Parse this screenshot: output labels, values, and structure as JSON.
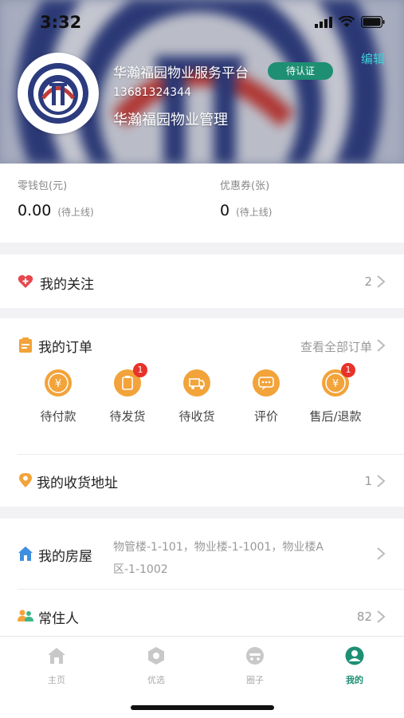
{
  "status": {
    "time": "3:32"
  },
  "profile": {
    "name": "华瀚福园物业服务平台",
    "badge": "待认证",
    "phone": "13681324344",
    "org": "华瀚福园物业管理",
    "edit": "编辑"
  },
  "wallet": {
    "balance_label": "零钱包(元)",
    "balance_value": "0.00",
    "balance_tag": "(待上线)",
    "coupon_label": "优惠券(张)",
    "coupon_value": "0",
    "coupon_tag": "(待上线)"
  },
  "follow": {
    "label": "我的关注",
    "count": "2"
  },
  "orders": {
    "title": "我的订单",
    "view_all": "查看全部订单",
    "items": [
      {
        "label": "待付款",
        "badge": ""
      },
      {
        "label": "待发货",
        "badge": "1"
      },
      {
        "label": "待收货",
        "badge": ""
      },
      {
        "label": "评价",
        "badge": ""
      },
      {
        "label": "售后/退款",
        "badge": "1"
      }
    ]
  },
  "address": {
    "label": "我的收货地址",
    "count": "1"
  },
  "house": {
    "label": "我的房屋",
    "value_line1": "物管楼-1-101，物业楼-1-1001，物业楼A",
    "value_line2": "区-1-1002"
  },
  "residents": {
    "label": "常住人",
    "count": "82"
  },
  "tabs": [
    {
      "label": "主页",
      "icon": "home-icon"
    },
    {
      "label": "优选",
      "icon": "hexagon-icon"
    },
    {
      "label": "圈子",
      "icon": "community-icon"
    },
    {
      "label": "我的",
      "icon": "profile-icon"
    }
  ],
  "colors": {
    "accent": "#1e8f73",
    "order_icon": "#f2a33a",
    "badge": "#e8322a",
    "edit": "#3fd0d8"
  }
}
